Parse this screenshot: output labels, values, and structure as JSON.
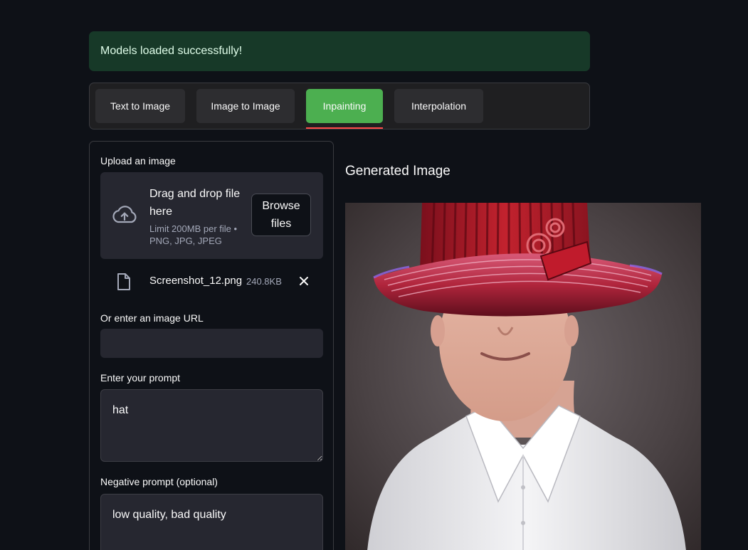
{
  "alert": {
    "text": "Models loaded successfully!"
  },
  "tabs": [
    {
      "label": "Text to Image",
      "active": false
    },
    {
      "label": "Image to Image",
      "active": false
    },
    {
      "label": "Inpainting",
      "active": true
    },
    {
      "label": "Interpolation",
      "active": false
    }
  ],
  "form": {
    "upload_label": "Upload an image",
    "dropzone": {
      "title": "Drag and drop file here",
      "limit": "Limit 200MB per file • PNG, JPG, JPEG",
      "browse_label": "Browse files"
    },
    "file": {
      "name": "Screenshot_12.png",
      "size": "240.8KB"
    },
    "url_label": "Or enter an image URL",
    "url_value": "",
    "prompt_label": "Enter your prompt",
    "prompt_value": "hat",
    "negative_label": "Negative prompt (optional)",
    "negative_value": "low quality, bad quality"
  },
  "output": {
    "title": "Generated Image"
  },
  "colors": {
    "background": "#0e1117",
    "alert_bg": "#173928",
    "active_tab": "#4caf50",
    "tab_underline": "#ff4b4b",
    "input_bg": "#262730"
  },
  "icons": [
    "cloud-upload-icon",
    "file-icon",
    "close-icon"
  ]
}
